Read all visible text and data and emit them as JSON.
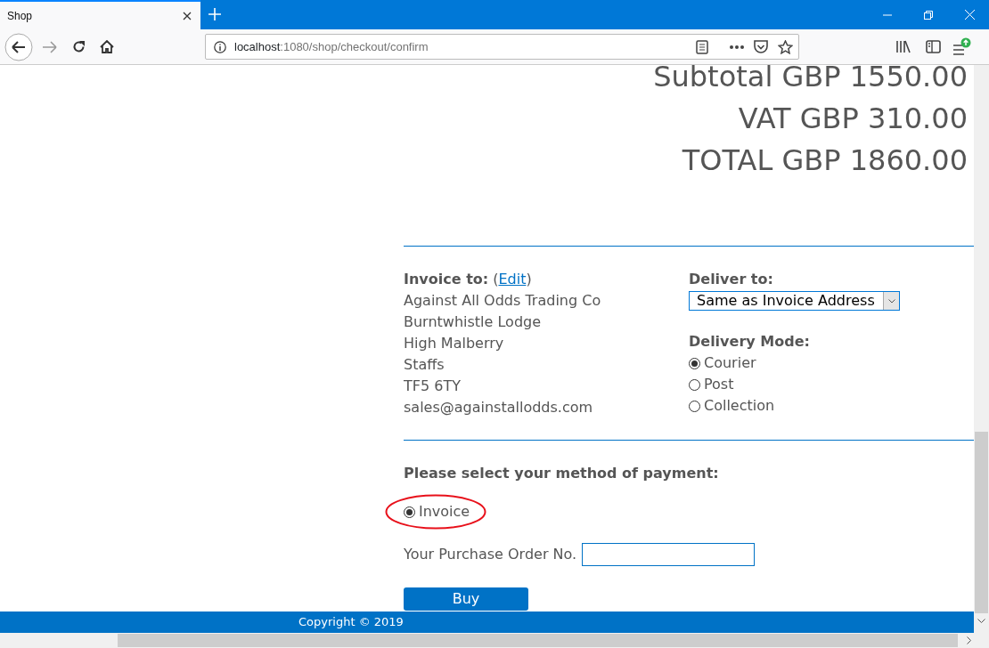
{
  "browser": {
    "tab_title": "Shop",
    "url_host": "localhost",
    "url_path": ":1080/shop/checkout/confirm"
  },
  "totals": [
    {
      "text": "Subtotal GBP 1550.00"
    },
    {
      "text": "VAT GBP 310.00"
    },
    {
      "text": "TOTAL GBP 1860.00"
    }
  ],
  "invoice": {
    "label": "Invoice to:",
    "open_paren": "(",
    "edit_link": "Edit",
    "close_paren": ")",
    "lines": [
      "Against All Odds Trading Co",
      "Burntwhistle Lodge",
      "High Malberry",
      "Staffs",
      "TF5 6TY",
      "sales@againstallodds.com"
    ]
  },
  "delivery": {
    "label": "Deliver to:",
    "select_value": "Same as Invoice Address",
    "mode_label": "Delivery Mode:",
    "modes": [
      {
        "label": "Courier",
        "selected": true
      },
      {
        "label": "Post",
        "selected": false
      },
      {
        "label": "Collection",
        "selected": false
      }
    ]
  },
  "payment": {
    "heading": "Please select your method of payment:",
    "options": [
      {
        "label": "Invoice",
        "selected": true,
        "circled": true
      }
    ],
    "po_label": "Your Purchase Order No.",
    "buy_button": "Buy"
  },
  "footer": {
    "copyright": "Copyright © 2019"
  }
}
